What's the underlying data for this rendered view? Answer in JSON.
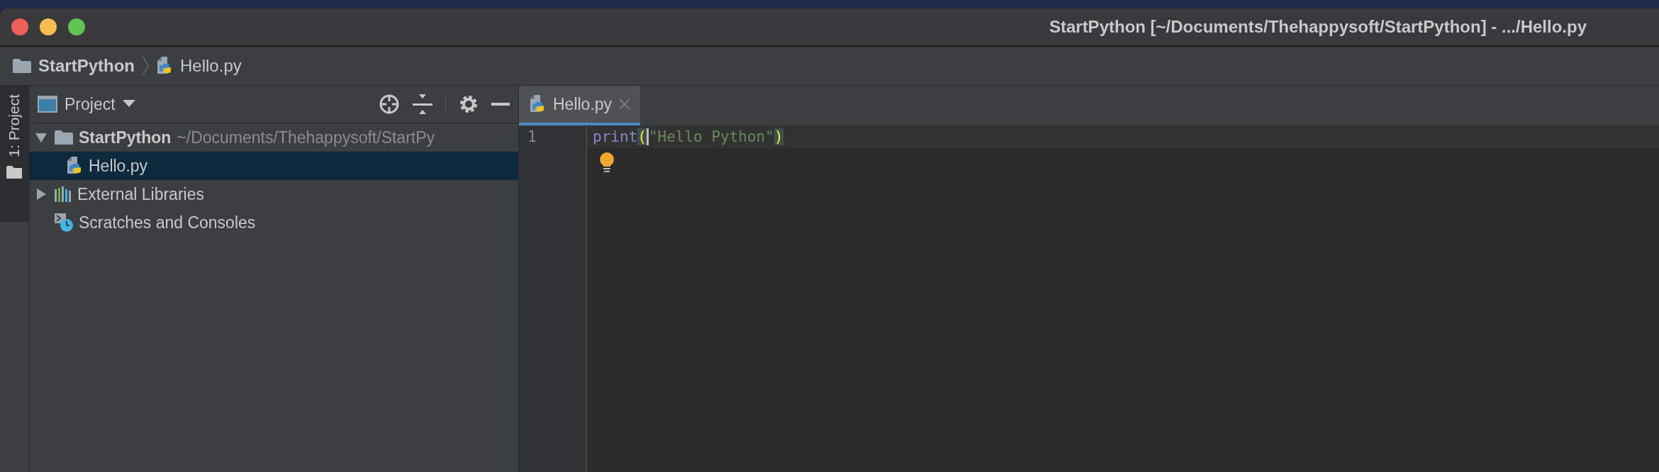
{
  "window": {
    "title": "StartPython [~/Documents/Thehappysoft/StartPython] - .../Hello.py"
  },
  "breadcrumb": [
    {
      "label": "StartPython",
      "kind": "folder"
    },
    {
      "label": "Hello.py",
      "kind": "python"
    }
  ],
  "tool_stripe": {
    "label": "1: Project",
    "selected": true
  },
  "project_panel": {
    "title": "Project",
    "tree": [
      {
        "label": "StartPython",
        "path": "~/Documents/Thehappysoft/StartPy",
        "kind": "folder",
        "expanded": true,
        "selected": false,
        "children": [
          {
            "label": "Hello.py",
            "kind": "python",
            "selected": true
          }
        ]
      },
      {
        "label": "External Libraries",
        "kind": "libraries",
        "expanded": false,
        "selected": false
      },
      {
        "label": "Scratches and Consoles",
        "kind": "scratches",
        "selected": false
      }
    ]
  },
  "tabs": [
    {
      "label": "Hello.py",
      "selected": true
    }
  ],
  "editor": {
    "lines": [
      {
        "number": "1",
        "tokens": [
          {
            "text": "print",
            "kind": "builtin"
          },
          {
            "text": "(",
            "kind": "bracket"
          },
          {
            "text": "\"Hello Python\"",
            "kind": "string"
          },
          {
            "text": ")",
            "kind": "bracket"
          }
        ]
      }
    ]
  }
}
